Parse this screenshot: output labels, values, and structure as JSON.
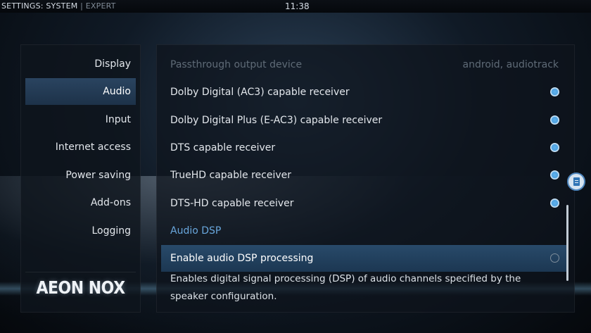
{
  "header": {
    "title": "SETTINGS: SYSTEM",
    "separator": "|",
    "mode": "EXPERT",
    "clock": "11:38"
  },
  "sidebar": {
    "items": [
      {
        "label": "Display"
      },
      {
        "label": "Audio",
        "selected": true
      },
      {
        "label": "Input"
      },
      {
        "label": "Internet access"
      },
      {
        "label": "Power saving"
      },
      {
        "label": "Add-ons"
      },
      {
        "label": "Logging"
      }
    ],
    "logo": "AEON NOX"
  },
  "settings": {
    "passthrough_device": {
      "label": "Passthrough output device",
      "value": "android, audiotrack",
      "enabled": false
    },
    "ac3": {
      "label": "Dolby Digital (AC3) capable receiver",
      "checked": true
    },
    "eac3": {
      "label": "Dolby Digital Plus (E-AC3) capable receiver",
      "checked": true
    },
    "dts": {
      "label": "DTS capable receiver",
      "checked": true
    },
    "truehd": {
      "label": "TrueHD capable receiver",
      "checked": true
    },
    "dtshd": {
      "label": "DTS-HD capable receiver",
      "checked": true
    },
    "section_audio_dsp": {
      "label": "Audio DSP"
    },
    "enable_dsp": {
      "label": "Enable audio DSP processing",
      "checked": false,
      "focused": true
    }
  },
  "description": "Enables digital signal processing (DSP) of audio channels specified by the speaker configuration.",
  "icons": {
    "info": "document-info-icon",
    "radio_on": "radio-on-icon",
    "radio_off": "radio-off-icon"
  },
  "colors": {
    "accent": "#4fa2e0",
    "section": "#69a7dd",
    "selection": "#284a6a"
  }
}
